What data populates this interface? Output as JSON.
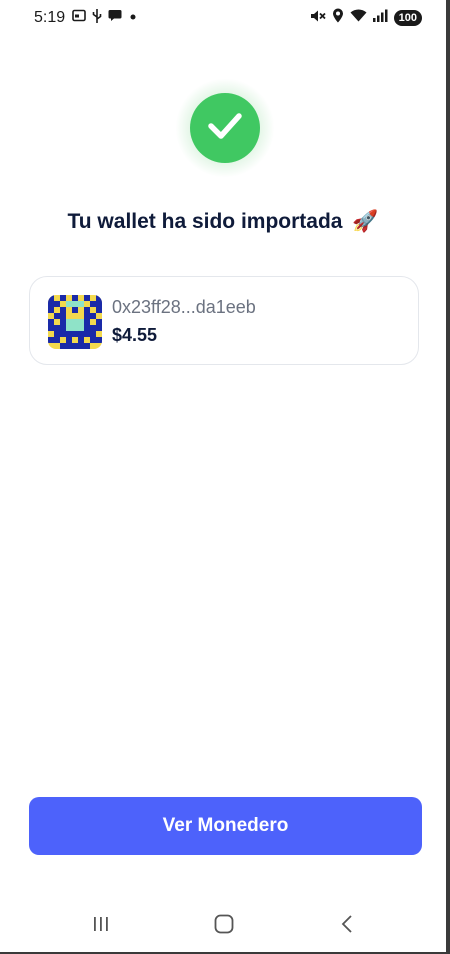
{
  "status_bar": {
    "time": "5:19",
    "battery": "100",
    "left_icons": [
      "calendar-icon",
      "usb-icon",
      "chat-bubble-icon",
      "dot-icon"
    ],
    "right_icons": [
      "mute-icon",
      "location-icon",
      "wifi-icon",
      "signal-icon"
    ]
  },
  "success": {
    "icon": "check-icon",
    "color": "#40c862"
  },
  "title": {
    "text": "Tu wallet ha sido importada",
    "emoji": "🚀"
  },
  "wallet": {
    "address": "0x23ff28...da1eeb",
    "balance": "$4.55",
    "avatar_icon": "identicon-avatar"
  },
  "primary_button": {
    "label": "Ver Monedero",
    "color": "#4d62fb"
  },
  "nav": {
    "recents": "recents-icon",
    "home": "home-icon",
    "back": "back-icon"
  }
}
